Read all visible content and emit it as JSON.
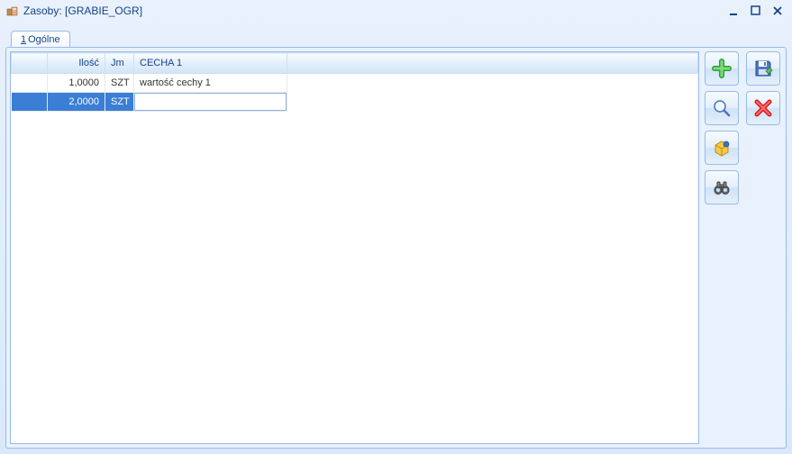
{
  "window": {
    "title": "Zasoby: [GRABIE_OGR]"
  },
  "tabs": {
    "general": {
      "accel": "1",
      "label": "Ogólne"
    }
  },
  "grid": {
    "headers": {
      "index": "",
      "ilosc": "Ilość",
      "jm": "Jm",
      "cecha1": "CECHA 1"
    },
    "rows": [
      {
        "ilosc": "1,0000",
        "jm": "SZT",
        "cecha1": "wartość cechy 1",
        "selected": false
      },
      {
        "ilosc": "2,0000",
        "jm": "SZT",
        "cecha1": "",
        "selected": true,
        "editing_cecha": true
      }
    ]
  },
  "icons": {
    "add": "add-icon",
    "zoom": "magnifier-icon",
    "package": "package-icon",
    "binoculars": "binoculars-icon",
    "save": "save-icon",
    "cancel": "cancel-icon"
  }
}
